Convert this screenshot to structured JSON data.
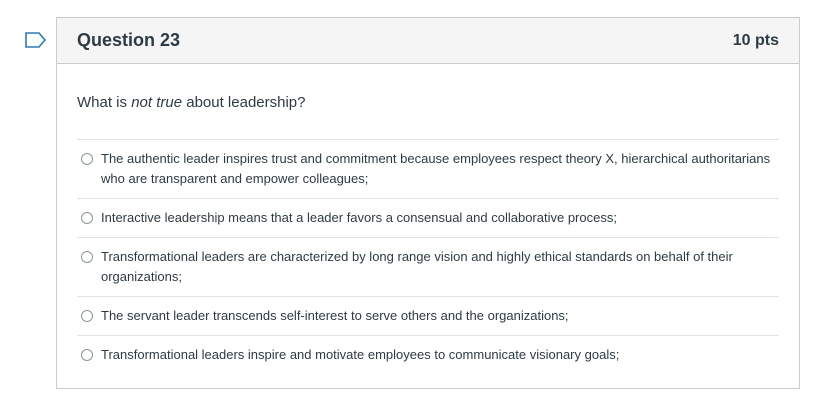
{
  "question": {
    "title": "Question 23",
    "points": "10 pts",
    "prompt_before": "What is ",
    "prompt_emphasis": "not true",
    "prompt_after": " about leadership?"
  },
  "answers": [
    {
      "label": "The authentic leader inspires trust and commitment because employees respect theory X, hierarchical authoritarians who are transparent and empower colleagues;"
    },
    {
      "label": "Interactive leadership means that a leader favors a consensual and collaborative process;"
    },
    {
      "label": "Transformational leaders are characterized by long range vision and highly ethical standards on behalf of their organizations;"
    },
    {
      "label": "The servant leader transcends self-interest to serve others and the organizations;"
    },
    {
      "label": "Transformational leaders inspire and motivate employees to communicate visionary goals;"
    }
  ],
  "icons": {
    "flag": "flag-question-icon"
  },
  "colors": {
    "flag": "#2b7abc",
    "border": "#c7cdd1",
    "header_bg": "#f5f5f5",
    "text": "#2d3b45"
  }
}
